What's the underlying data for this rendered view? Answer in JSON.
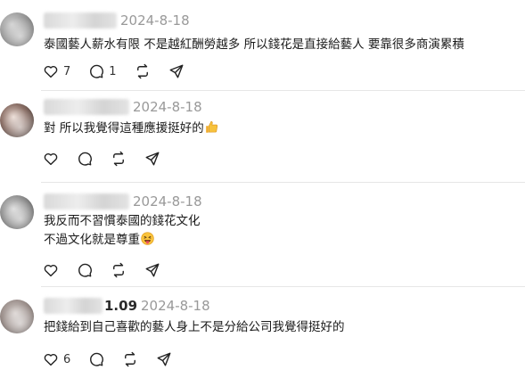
{
  "comments": [
    {
      "name_tail": "",
      "date": "2024-8-18",
      "lines": [
        "泰國藝人薪水有限 不是越紅酬勞越多 所以錢花是直接給藝人 要靠很多商演累積"
      ],
      "likes": "7",
      "replies": "1",
      "reposts": "",
      "emoji": ""
    },
    {
      "name_tail": "",
      "date": "2024-8-18",
      "lines": [
        "對 所以我覺得這種應援挺好的"
      ],
      "likes": "",
      "replies": "",
      "reposts": "",
      "emoji": "thumbs-up"
    },
    {
      "name_tail": "",
      "date": "2024-8-18",
      "lines": [
        "我反而不習慣泰國的錢花文化",
        "不過文化就是尊重"
      ],
      "likes": "",
      "replies": "",
      "reposts": "",
      "emoji": "tongue-face"
    },
    {
      "name_tail": "1.09",
      "date": "2024-8-18",
      "lines": [
        "把錢給到自己喜歡的藝人身上不是分給公司我覺得挺好的"
      ],
      "likes": "6",
      "replies": "",
      "reposts": "",
      "emoji": ""
    }
  ],
  "icons": {
    "like": "heart-icon",
    "reply": "comment-icon",
    "repost": "repost-icon",
    "share": "send-icon"
  },
  "colors": {
    "date": "#999999",
    "text": "#1a1a1a",
    "divider": "#e6e6e6"
  }
}
